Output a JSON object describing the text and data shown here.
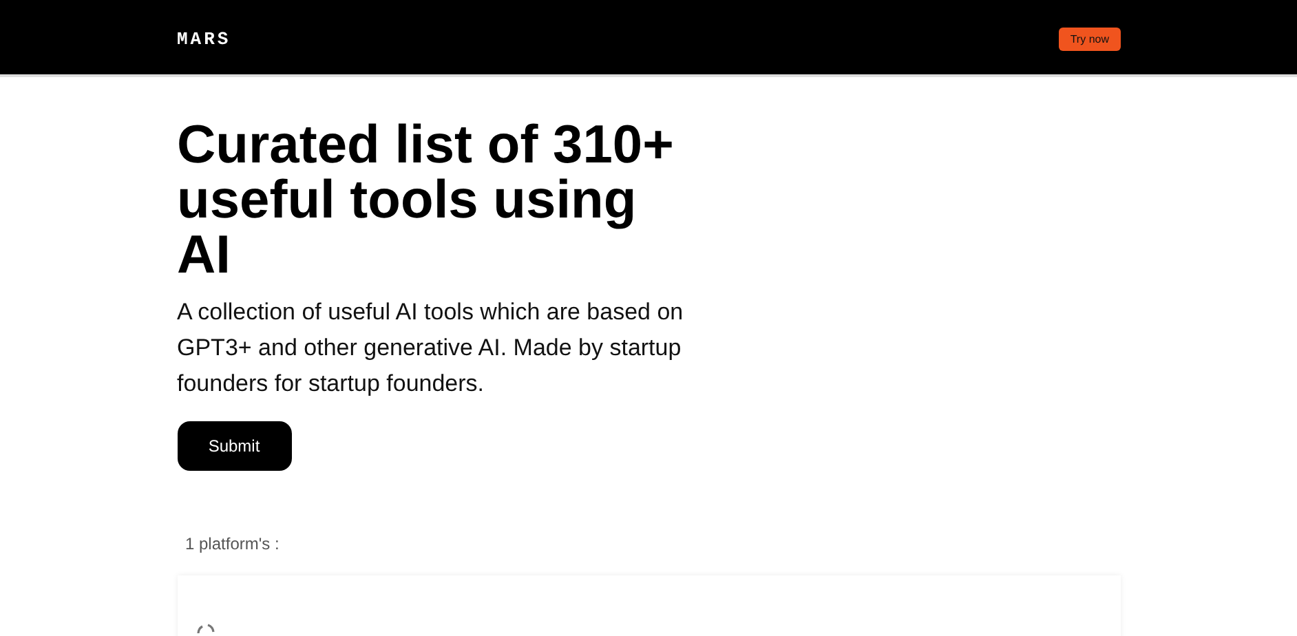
{
  "header": {
    "logo": "MARS",
    "cta": "Try now"
  },
  "hero": {
    "title": "Curated list of 310+ useful tools using AI",
    "subtitle": "A collection of useful AI tools which are based on GPT3+ and other generative AI. Made by startup founders for startup founders.",
    "button": "Submit"
  },
  "platforms": {
    "count_label": "1 platform's :"
  }
}
